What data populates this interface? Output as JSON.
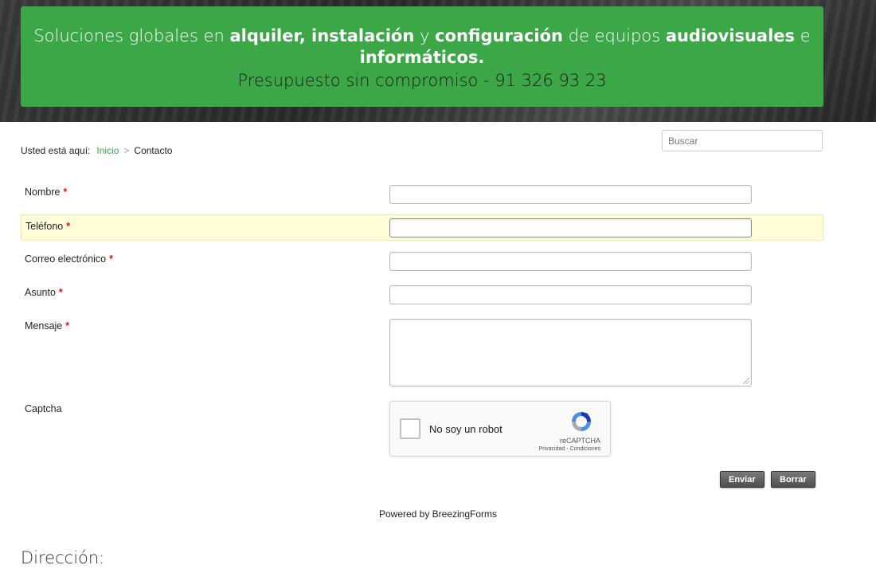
{
  "banner": {
    "line1_a": "Soluciones globales en ",
    "line1_b": "alquiler, instalación",
    "line1_c": " y ",
    "line1_d": "configuración",
    "line1_e": " de equipos ",
    "line1_f": "audiovisuales",
    "line1_g": " e",
    "line2": "informáticos.",
    "line3": "Presupuesto sin compromiso - 91 326 93 23"
  },
  "search": {
    "placeholder": "Buscar"
  },
  "breadcrumb": {
    "here": "Usted está aquí:",
    "home": "Inicio",
    "separator": ">",
    "current": "Contacto"
  },
  "form": {
    "fields": [
      {
        "label": "Nombre",
        "required": "*"
      },
      {
        "label": "Teléfono",
        "required": "*"
      },
      {
        "label": "Correo electrónico",
        "required": "*"
      },
      {
        "label": "Asunto",
        "required": "*"
      },
      {
        "label": "Mensaje",
        "required": "*"
      }
    ],
    "captcha_label": "Captcha",
    "captcha": {
      "checkbox_text": "No soy un robot",
      "brand": "reCAPTCHA",
      "links": "Privacidad - Condiciones"
    },
    "submit_label": "Enviar",
    "reset_label": "Borrar"
  },
  "powered": "Powered by BreezingForms",
  "address_heading": "Dirección:",
  "colors": {
    "accent": "#3ca746",
    "highlight": "#fffcd8",
    "required": "#d11111"
  }
}
